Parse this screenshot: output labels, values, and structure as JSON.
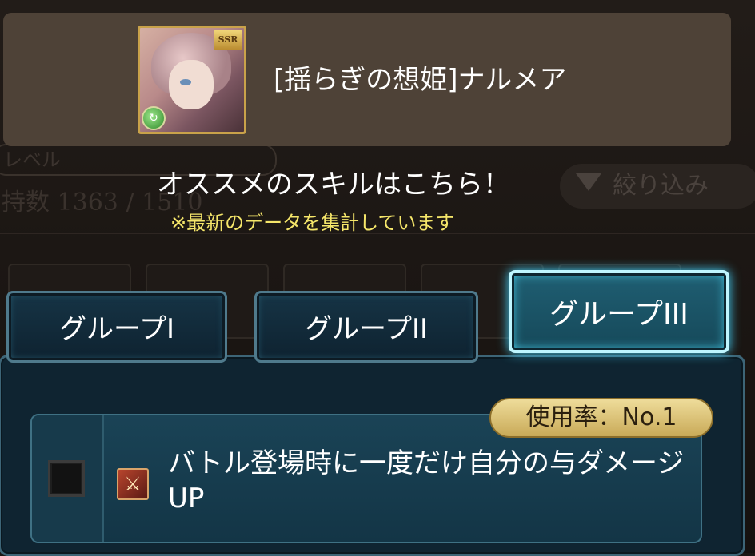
{
  "background": {
    "level_label": "レベル",
    "possession_label": "持数 1363 / 1510",
    "filter_label": "絞り込み"
  },
  "character": {
    "name": "[揺らぎの想姫]ナルメア",
    "rarity": "SSR",
    "element_icon": "wind-element-icon"
  },
  "recommend": {
    "title": "オススメのスキルはこちら！",
    "note": "※最新のデータを集計しています"
  },
  "tabs": [
    {
      "label": "グループI",
      "active": false
    },
    {
      "label": "グループII",
      "active": false
    },
    {
      "label": "グループIII",
      "active": true
    }
  ],
  "skill": {
    "usage_badge": "使用率：No.1",
    "icon": "crossed-swords-icon",
    "description": "バトル登場時に一度だけ自分の与ダメージUP"
  },
  "colors": {
    "accent_cyan": "#45d6ff",
    "badge_gold": "#e2cc82",
    "note_yellow": "#f5e66a"
  }
}
